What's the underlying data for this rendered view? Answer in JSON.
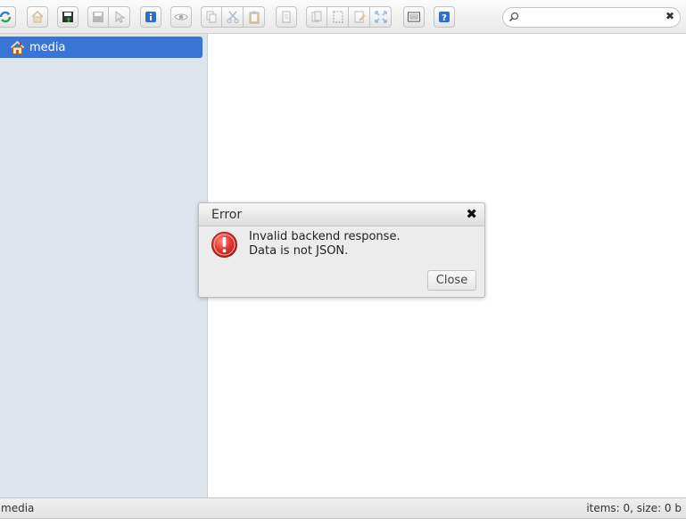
{
  "toolbar": {
    "search": {
      "value": "",
      "placeholder": ""
    },
    "icons": [
      "reload-icon",
      "home-icon",
      "save-icon",
      "save-disabled-icon",
      "select-disabled-icon",
      "info-icon",
      "view-icon",
      "copy-icon",
      "cut-icon",
      "paste-icon",
      "rename-icon",
      "duplicate-icon",
      "select-icon",
      "edit-icon",
      "resize-icon",
      "view-list-icon",
      "help-icon"
    ]
  },
  "navbar": {
    "items": [
      {
        "label": "media",
        "selected": true
      }
    ]
  },
  "statusbar": {
    "path": "media",
    "info": "items: 0, size: 0 b"
  },
  "dialog": {
    "title": "Error",
    "close_glyph": "✖",
    "message_line1": "Invalid backend response.",
    "message_line2": "Data is not JSON.",
    "button_label": "Close"
  },
  "colors": {
    "accent": "#3875d7",
    "navbar_bg": "#dde4ec",
    "error_red": "#e0312b"
  }
}
